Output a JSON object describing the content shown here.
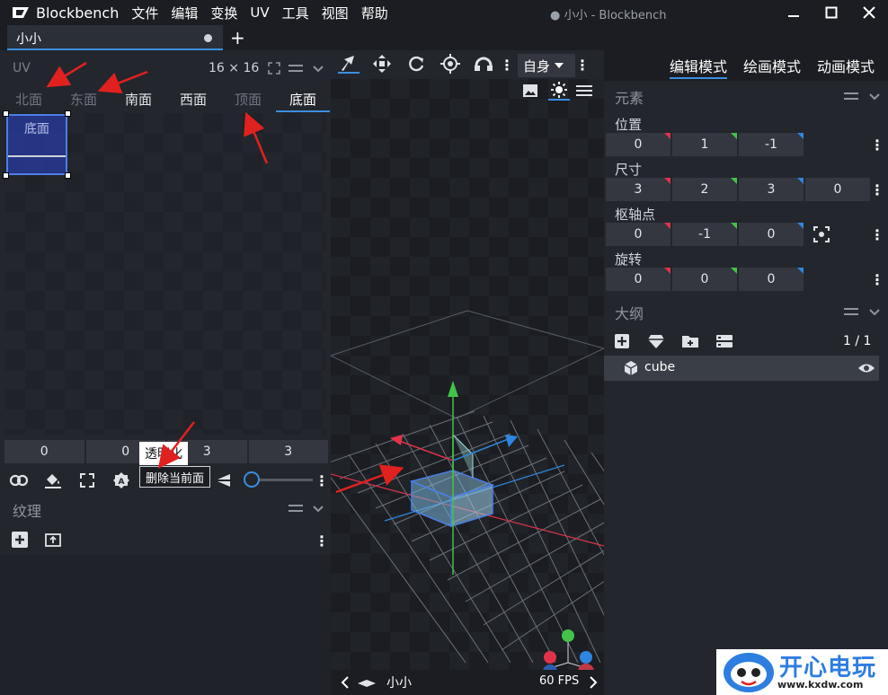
{
  "app": {
    "name": "Blockbench",
    "window_title": "● 小小 - Blockbench",
    "menu": [
      "文件",
      "编辑",
      "变换",
      "UV",
      "工具",
      "视图",
      "帮助"
    ]
  },
  "tabs": [
    {
      "label": "小小",
      "modified": true
    }
  ],
  "uv_panel": {
    "title": "UV",
    "size": "16 × 16",
    "faces": [
      {
        "label": "北面",
        "state": "dim"
      },
      {
        "label": "东面",
        "state": "dim"
      },
      {
        "label": "南面",
        "state": "normal"
      },
      {
        "label": "西面",
        "state": "normal"
      },
      {
        "label": "顶面",
        "state": "dim"
      },
      {
        "label": "底面",
        "state": "selected"
      }
    ],
    "selected_face_label": "底面",
    "inputs": [
      "0",
      "0",
      "3",
      "3"
    ],
    "tooltip_title": "透明化",
    "tooltip_hint": "删除当前面"
  },
  "textures_panel": {
    "title": "纹理"
  },
  "viewport": {
    "space_mode": "自身",
    "model_name": "小小",
    "fps": "60 FPS"
  },
  "modes": [
    "编辑模式",
    "绘画模式",
    "动画模式"
  ],
  "element_panel": {
    "title": "元素",
    "position_label": "位置",
    "position": [
      "0",
      "1",
      "-1"
    ],
    "size_label": "尺寸",
    "size": [
      "3",
      "2",
      "3",
      "0"
    ],
    "pivot_label": "枢轴点",
    "pivot": [
      "0",
      "-1",
      "0"
    ],
    "rotation_label": "旋转",
    "rotation": [
      "0",
      "0",
      "0"
    ]
  },
  "outliner": {
    "title": "大纲",
    "count": "1 / 1",
    "items": [
      {
        "label": "cube"
      }
    ]
  },
  "watermark": {
    "text": "开心电玩",
    "url": "www.kxdw.com"
  },
  "colors": {
    "accent": "#3c8ee0",
    "annotation_arrow": "#e0211f",
    "axis_x": "#e0334a",
    "axis_y": "#44c24a",
    "axis_z": "#2e86de"
  }
}
